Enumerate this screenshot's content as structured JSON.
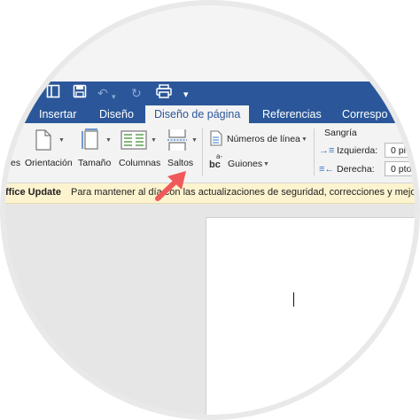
{
  "quick_access": {
    "icons": [
      "sidebar-icon",
      "save-icon",
      "undo-icon",
      "redo-icon",
      "print-icon",
      "customize-icon"
    ]
  },
  "tabs": [
    {
      "label": "Insertar",
      "active": false
    },
    {
      "label": "Diseño",
      "active": false
    },
    {
      "label": "Diseño de página",
      "active": true
    },
    {
      "label": "Referencias",
      "active": false
    },
    {
      "label": "Correspo",
      "active": false
    }
  ],
  "ribbon": {
    "margins_partial": "es",
    "orientation": "Orientación",
    "size": "Tamaño",
    "columns": "Columnas",
    "breaks": "Saltos",
    "line_numbers": "Números de línea",
    "hyphenation": "Guiones",
    "indent_title": "Sangría",
    "indent_left_label": "Izquierda:",
    "indent_left_value": "0 pi",
    "indent_right_label": "Derecha:",
    "indent_right_value": "0 pto",
    "hyphen_icon_text": "bc",
    "hyphen_icon_sup": "a-"
  },
  "message_bar": {
    "title": "ffice Update",
    "text": "Para mantener al día con las actualizaciones de seguridad, correcciones y mejo"
  },
  "colors": {
    "ribbon_blue": "#2b579a",
    "arrow_red": "#f05a5a",
    "message_bg": "#fdf3cf"
  }
}
